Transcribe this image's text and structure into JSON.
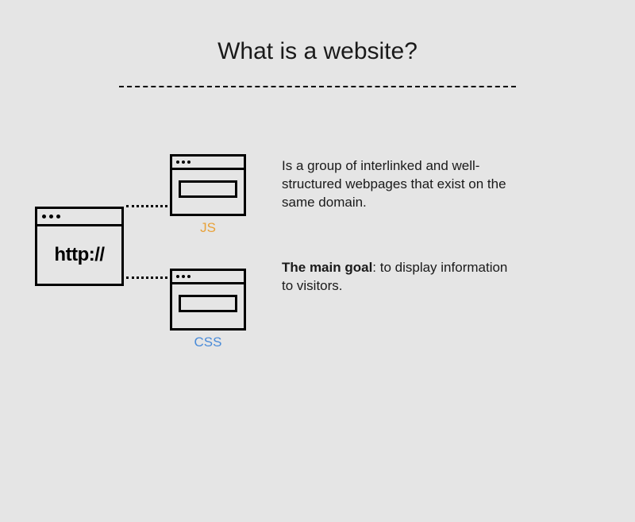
{
  "title": "What is a website?",
  "mainWindow": {
    "label": "http://"
  },
  "miniWindows": {
    "js": {
      "label": "JS"
    },
    "css": {
      "label": "CSS"
    }
  },
  "paragraphs": {
    "definition": "Is a group of interlinked and well-structured webpages that exist on the same domain.",
    "mainGoalLabel": "The main goal",
    "mainGoalRest": ": to display information to visitors."
  },
  "colors": {
    "js": "#e8a23a",
    "css": "#4a8bd8"
  }
}
